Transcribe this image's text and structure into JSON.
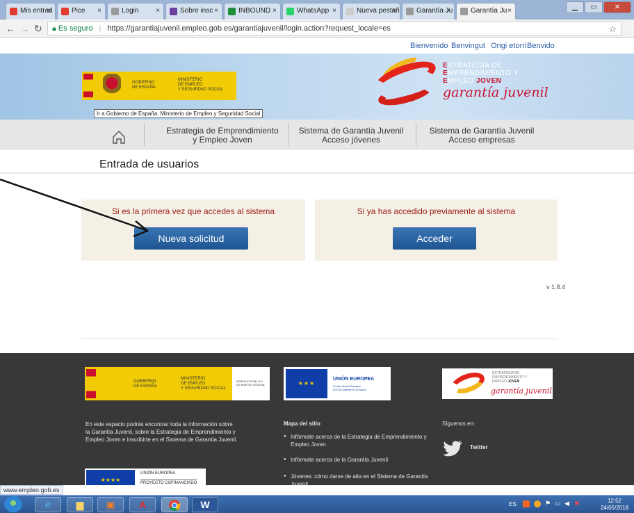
{
  "browser": {
    "tabs": [
      {
        "title": "Mis entrad",
        "color": "#e23b2f"
      },
      {
        "title": "Pice",
        "color": "#e23b2f"
      },
      {
        "title": "Login",
        "color": "#9a9a9a"
      },
      {
        "title": "Sobre insc",
        "color": "#6b3fa0"
      },
      {
        "title": "INBOUND",
        "color": "#1e8e3e"
      },
      {
        "title": "WhatsApp",
        "color": "#25d366"
      },
      {
        "title": "Nueva pestaña",
        "color": "#cccccc"
      },
      {
        "title": "Garantía Ju",
        "color": "#9a9a9a"
      },
      {
        "title": "Garantía Ju",
        "color": "#9a9a9a",
        "active": true
      }
    ],
    "address": {
      "secure_label": "Es seguro",
      "url": "https://garantiajuvenil.empleo.gob.es/garantiajuvenil/login.action?request_locale=es"
    },
    "status_url": "www.empleo.gob.es"
  },
  "site": {
    "languages": [
      "Bienvenido",
      "Benvingut",
      "Ongi etorri",
      "Benvido"
    ],
    "gov_logo": {
      "line1": "GOBIERNO",
      "line2": "DE ESPAÑA",
      "ministry1": "MINISTERIO",
      "ministry2": "DE EMPLEO",
      "ministry3": "Y SEGURIDAD SOCIAL"
    },
    "tooltip": "Ir a Gobierno de España. Ministerio de Empleo y Seguridad Social",
    "gj_logo": {
      "line1_initial": "E",
      "line1_rest": "STRATEGIA DE",
      "line2_initial": "E",
      "line2_rest": "MPRENDIMIENTO Y",
      "line3_initial": "E",
      "line3_rest": "MPLEO",
      "line3_bold": "JOVEN",
      "script": "garantía juvenil"
    },
    "nav": {
      "home_icon": "home-icon",
      "items": [
        {
          "line1": "Estrategia de Emprendimiento",
          "line2": "y Empleo Joven"
        },
        {
          "line1": "Sistema de Garantía Juvenil",
          "line2": "Acceso jóvenes"
        },
        {
          "line1": "Sistema de Garantía Juvenil",
          "line2": "Acceso empresas"
        }
      ]
    },
    "page_title": "Entrada de usuarios",
    "panels": {
      "first_time": {
        "message": "Si es la primera vez que accedes al sistema",
        "button": "Nueva solicitud"
      },
      "returning": {
        "message": "Si ya has accedido previamente al sistema",
        "button": "Acceder"
      }
    },
    "version": "v 1.8.4",
    "footer": {
      "gov": {
        "line1": "GOBIERNO",
        "line2": "DE ESPAÑA",
        "ministry1": "MINISTERIO",
        "ministry2": "DE EMPLEO",
        "ministry3": "Y SEGURIDAD SOCIAL",
        "sepe1": "SERVICIO PÚBLICO",
        "sepe2": "DE EMPLEO ESTATAL"
      },
      "eu": {
        "title": "UNIÓN EUROPEA",
        "sub1": "Fondo Social Europeo",
        "sub2": "El FSE invierte en tu futuro"
      },
      "gj": {
        "a1": "ESTRATEGIA DE",
        "a2": "EMPRENDIMIENTO Y",
        "a3": "EMPLEO",
        "a3b": "JOVEN",
        "script": "garantía juvenil"
      },
      "about": "En este espacio podrás encontrar toda la información sobre la Garantía Juvenil, sobre la Estrategia de Emprendimiento y Empleo Joven e inscribirte en el Sistema de Garantía Juvenil.",
      "sitemap_heading": "Mapa del sitio",
      "sitemap_links": [
        "Infórmate acerca de la Estrategia de Emprendimiento y Empleo Joven",
        "Infórmate acerca de la Garantía Juvenil",
        "Jóvenes: cómo darse de alta en el Sistema de Garantía Juvenil"
      ],
      "follow_label": "Síguenos en:",
      "twitter_label": "Twitter",
      "eu2": {
        "a": "UNIÓN EUROPEA",
        "b": "PROYECTO COFINANCIADO"
      }
    }
  },
  "taskbar": {
    "apps": [
      "internet-explorer-icon",
      "file-explorer-icon",
      "media-player-icon",
      "acrobat-icon",
      "chrome-icon",
      "word-icon"
    ],
    "lang": "ES",
    "time": "12:52",
    "date": "24/05/2018"
  }
}
